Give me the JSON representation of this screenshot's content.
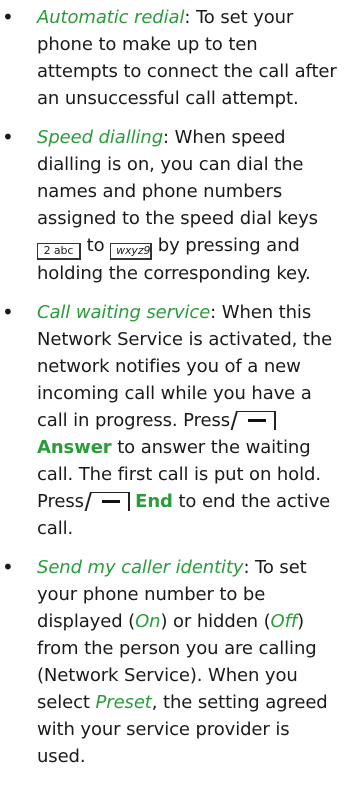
{
  "bullet_glyph": "•",
  "items": [
    {
      "term": "Automatic redial",
      "text": ": To set your phone to make up to ten attempts to connect the call after an unsuccessful call attempt."
    },
    {
      "term": "Speed dialling",
      "text_1": ": When speed dialling is on, you can dial the names and phone numbers assigned to the speed dial keys ",
      "key_from": "2 abc",
      "text_2": " to ",
      "key_to": "wxyz9",
      "text_3": " by pressing and holding the corresponding key."
    },
    {
      "term": "Call waiting service",
      "text_1": ": When this Network Service is activated, the network notifies you of a new incoming call while you have a call in progress. Press ",
      "softkey_1": "Answer",
      "text_2": " to answer the waiting call. The first call is put on hold. Press ",
      "softkey_2": "End",
      "text_3": " to end the active call."
    },
    {
      "term": "Send my caller identity",
      "text_1": ": To set your phone number to be displayed (",
      "opt_on": "On",
      "text_2": ") or hidden (",
      "opt_off": "Off",
      "text_3": ") from the person you are calling (Network Service). When you select ",
      "opt_preset": "Preset",
      "text_4": ", the setting agreed with your service provider is used."
    }
  ],
  "colors": {
    "accent": "#2a9c3a",
    "text": "#1a1a1a"
  },
  "icons": {
    "selection_key": "selection-key-icon"
  }
}
